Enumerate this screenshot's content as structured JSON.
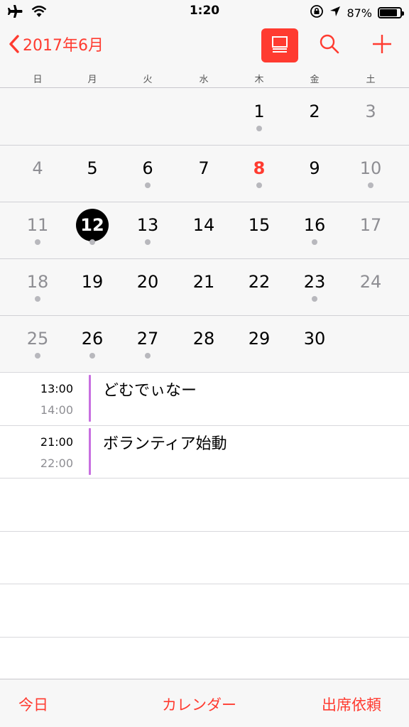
{
  "status_bar": {
    "time": "1:20",
    "battery_percent": "87%",
    "battery_level": 0.87,
    "icons": [
      "airplane-icon",
      "wifi-icon",
      "orientation-lock-icon",
      "location-arrow-icon",
      "battery-icon"
    ]
  },
  "nav": {
    "back_label": "2017年6月",
    "list_view_icon": "list-view-icon",
    "search_icon": "search-icon",
    "add_icon": "plus-icon",
    "accent_color": "#ff3b30"
  },
  "weekdays": [
    "日",
    "月",
    "火",
    "水",
    "木",
    "金",
    "土"
  ],
  "calendar": {
    "weeks": [
      [
        null,
        null,
        null,
        null,
        {
          "n": "1",
          "dot": true
        },
        {
          "n": "2"
        },
        {
          "n": "3"
        }
      ],
      [
        {
          "n": "4"
        },
        {
          "n": "5"
        },
        {
          "n": "6",
          "dot": true
        },
        {
          "n": "7"
        },
        {
          "n": "8",
          "dot": true,
          "today_red": true
        },
        {
          "n": "9"
        },
        {
          "n": "10",
          "dot": true
        }
      ],
      [
        {
          "n": "11",
          "dot": true
        },
        {
          "n": "12",
          "dot": true,
          "selected": true
        },
        {
          "n": "13",
          "dot": true
        },
        {
          "n": "14"
        },
        {
          "n": "15"
        },
        {
          "n": "16",
          "dot": true
        },
        {
          "n": "17"
        }
      ],
      [
        {
          "n": "18",
          "dot": true
        },
        {
          "n": "19"
        },
        {
          "n": "20"
        },
        {
          "n": "21"
        },
        {
          "n": "22"
        },
        {
          "n": "23",
          "dot": true
        },
        {
          "n": "24"
        }
      ],
      [
        {
          "n": "25",
          "dot": true
        },
        {
          "n": "26",
          "dot": true
        },
        {
          "n": "27",
          "dot": true
        },
        {
          "n": "28"
        },
        {
          "n": "29"
        },
        {
          "n": "30"
        },
        null
      ]
    ]
  },
  "events": [
    {
      "start": "13:00",
      "end": "14:00",
      "title": "どむでぃなー",
      "color": "#c86fe0"
    },
    {
      "start": "21:00",
      "end": "22:00",
      "title": "ボランティア始動",
      "color": "#c86fe0"
    }
  ],
  "tabbar": {
    "today": "今日",
    "calendars": "カレンダー",
    "inbox": "出席依頼"
  }
}
